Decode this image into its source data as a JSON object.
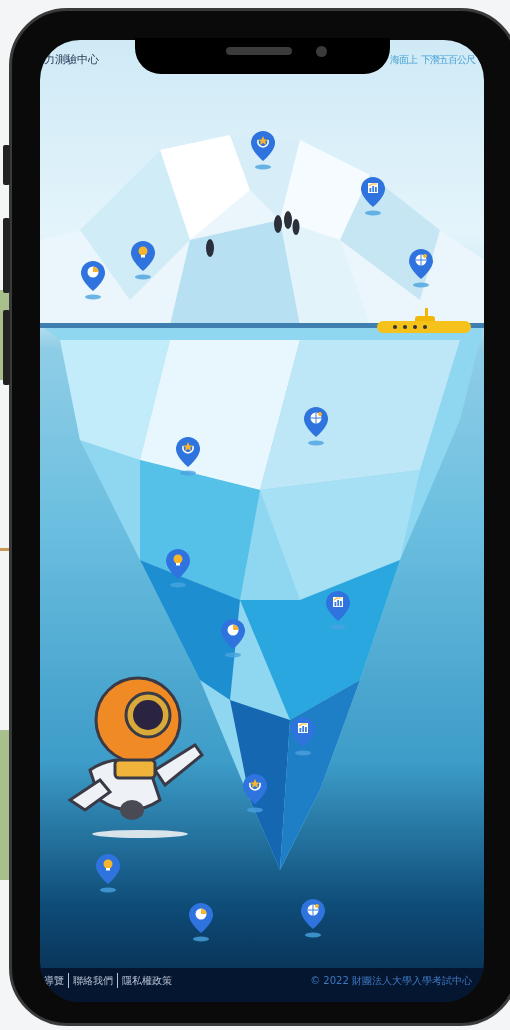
{
  "header": {
    "logo": "力測驗中心",
    "nav": [
      {
        "label": "海面上"
      },
      {
        "label": "下潛五百公尺"
      }
    ]
  },
  "markers": [
    {
      "kind": "laurel"
    },
    {
      "kind": "chart"
    },
    {
      "kind": "bulb"
    },
    {
      "kind": "pie"
    },
    {
      "kind": "globe"
    },
    {
      "kind": "globe"
    },
    {
      "kind": "laurel"
    },
    {
      "kind": "bulb"
    },
    {
      "kind": "chart"
    },
    {
      "kind": "pie"
    },
    {
      "kind": "chart"
    },
    {
      "kind": "laurel"
    },
    {
      "kind": "bulb"
    },
    {
      "kind": "pie"
    },
    {
      "kind": "globe"
    }
  ],
  "footer": {
    "links": [
      "導覽",
      "聯絡我們",
      "隱私權政策"
    ],
    "copyright": "© 2022 財團法人大學入學考試中心"
  }
}
